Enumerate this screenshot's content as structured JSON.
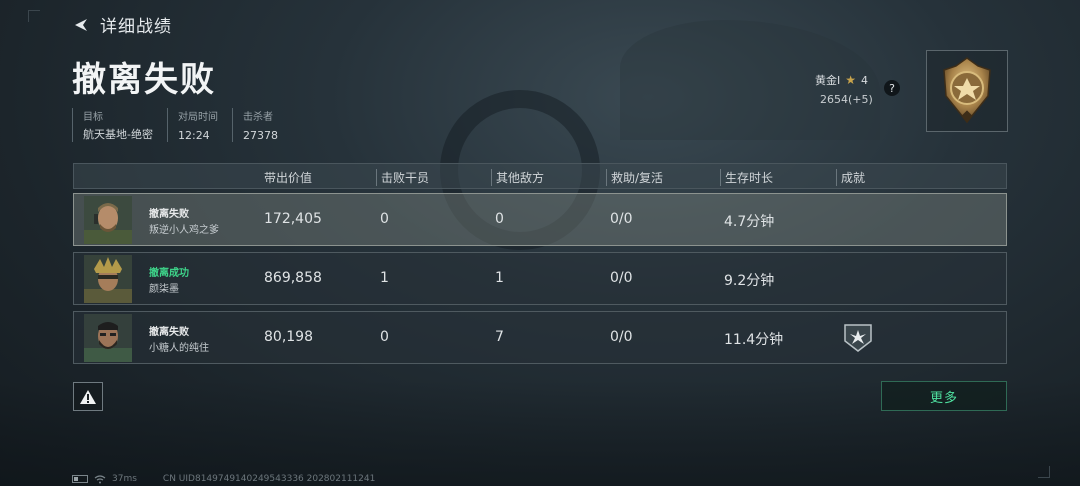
{
  "header": {
    "back_label": "详细战绩",
    "title": "撤离失败"
  },
  "meta": [
    {
      "key": "目标",
      "value": "航天基地-绝密"
    },
    {
      "key": "对局时间",
      "value": "12:24"
    },
    {
      "key": "击杀者",
      "value": "27378"
    }
  ],
  "rank": {
    "tier": "黄金I",
    "stars": "4",
    "score": "2654(+5)",
    "help": "?"
  },
  "table": {
    "headers": [
      "带出价值",
      "击败干员",
      "其他敌方",
      "救助/复活",
      "生存时长",
      "成就"
    ],
    "rows": [
      {
        "status": "撤离失败",
        "name": "叛逆小人鸡之爹",
        "value": "172,405",
        "kills": "0",
        "others": "0",
        "assist": "0/0",
        "time": "4.7分钟"
      },
      {
        "status": "撤离成功",
        "name": "颜柒墨",
        "value": "869,858",
        "kills": "1",
        "others": "1",
        "assist": "0/0",
        "time": "9.2分钟"
      },
      {
        "status": "撤离失败",
        "name": "小糖人的纯住",
        "value": "80,198",
        "kills": "0",
        "others": "7",
        "assist": "0/0",
        "time": "11.4分钟"
      }
    ]
  },
  "buttons": {
    "more": "更多"
  },
  "footer": {
    "ping": "37ms",
    "uid": "CN UID8149749140249543336 202802111241"
  },
  "colors": {
    "success": "#3ed48a",
    "accent_button": "#4fe0a0"
  }
}
